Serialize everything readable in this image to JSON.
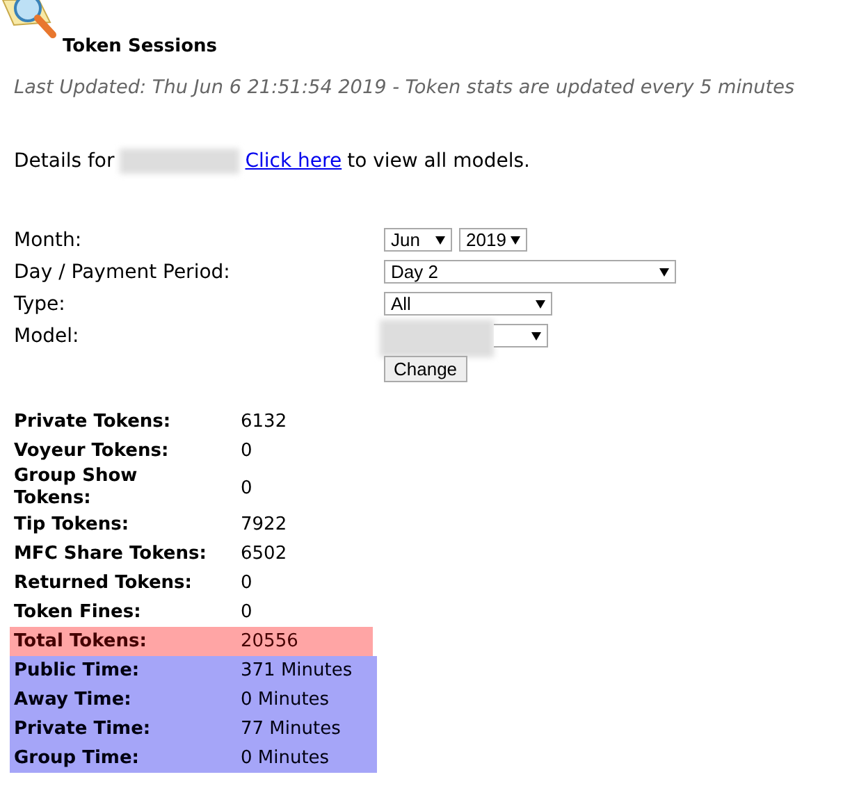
{
  "title": "Token Sessions",
  "last_updated": "Last Updated: Thu Jun 6 21:51:54 2019 - Token stats are updated every 5 minutes",
  "details": {
    "prefix": "Details for",
    "link": "Click here",
    "suffix": "to view all models."
  },
  "form": {
    "rows": [
      {
        "label": "Month:",
        "selects": [
          {
            "value": "Jun"
          },
          {
            "value": "2019"
          }
        ]
      },
      {
        "label": "Day / Payment Period:",
        "selects": [
          {
            "value": "Day 2"
          }
        ]
      },
      {
        "label": "Type:",
        "selects": [
          {
            "value": "All"
          }
        ]
      },
      {
        "label": "Model:"
      }
    ],
    "button": "Change"
  },
  "stats": [
    {
      "label": "Private Tokens:",
      "value": "6132",
      "kind": "plain"
    },
    {
      "label": "Voyeur Tokens:",
      "value": "0",
      "kind": "plain"
    },
    {
      "label": "Group Show Tokens:",
      "value": "0",
      "kind": "plain"
    },
    {
      "label": "Tip Tokens:",
      "value": "7922",
      "kind": "plain"
    },
    {
      "label": "MFC Share Tokens:",
      "value": "6502",
      "kind": "plain"
    },
    {
      "label": "Returned Tokens:",
      "value": "0",
      "kind": "plain"
    },
    {
      "label": "Token Fines:",
      "value": "0",
      "kind": "plain"
    },
    {
      "label": "Total Tokens:",
      "value": "20556",
      "kind": "total"
    },
    {
      "label": "Public Time:",
      "value": "371 Minutes",
      "kind": "time"
    },
    {
      "label": "Away Time:",
      "value": "0 Minutes",
      "kind": "time"
    },
    {
      "label": "Private Time:",
      "value": "77 Minutes",
      "kind": "time"
    },
    {
      "label": "Group Time:",
      "value": "0 Minutes",
      "kind": "time"
    }
  ]
}
